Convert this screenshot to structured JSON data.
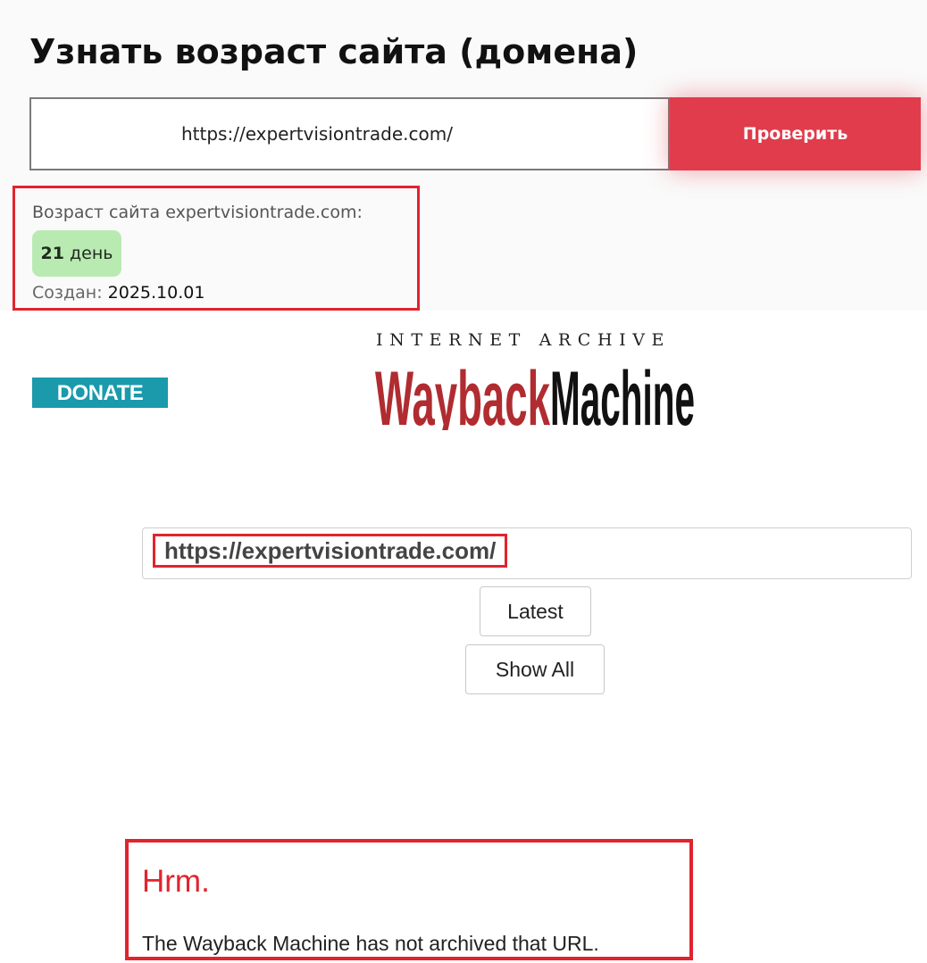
{
  "age_checker": {
    "title": "Узнать возраст сайта (домена)",
    "input_value": "https://expertvisiontrade.com/",
    "check_button_label": "Проверить",
    "result": {
      "label": "Возраст сайта expertvisiontrade.com:",
      "age_number": "21",
      "age_unit": "день",
      "created_label": "Создан:",
      "created_date": "2025.10.01"
    },
    "colors": {
      "button": "#e03c4c",
      "badge": "#b9eab2",
      "highlight_border": "#e0242e"
    }
  },
  "wayback": {
    "donate_label": "DONATE",
    "logo": {
      "top_text": "INTERNET ARCHIVE",
      "part1": "Wayback",
      "part2": "Machine",
      "colors": {
        "part1": "#b02c30",
        "part2": "#111111"
      }
    },
    "url_value": "https://expertvisiontrade.com/",
    "latest_label": "Latest",
    "show_all_label": "Show All",
    "error": {
      "title": "Hrm.",
      "message": "The Wayback Machine has not archived that URL."
    },
    "colors": {
      "donate": "#1a9aab",
      "error_title": "#e0242e"
    }
  }
}
